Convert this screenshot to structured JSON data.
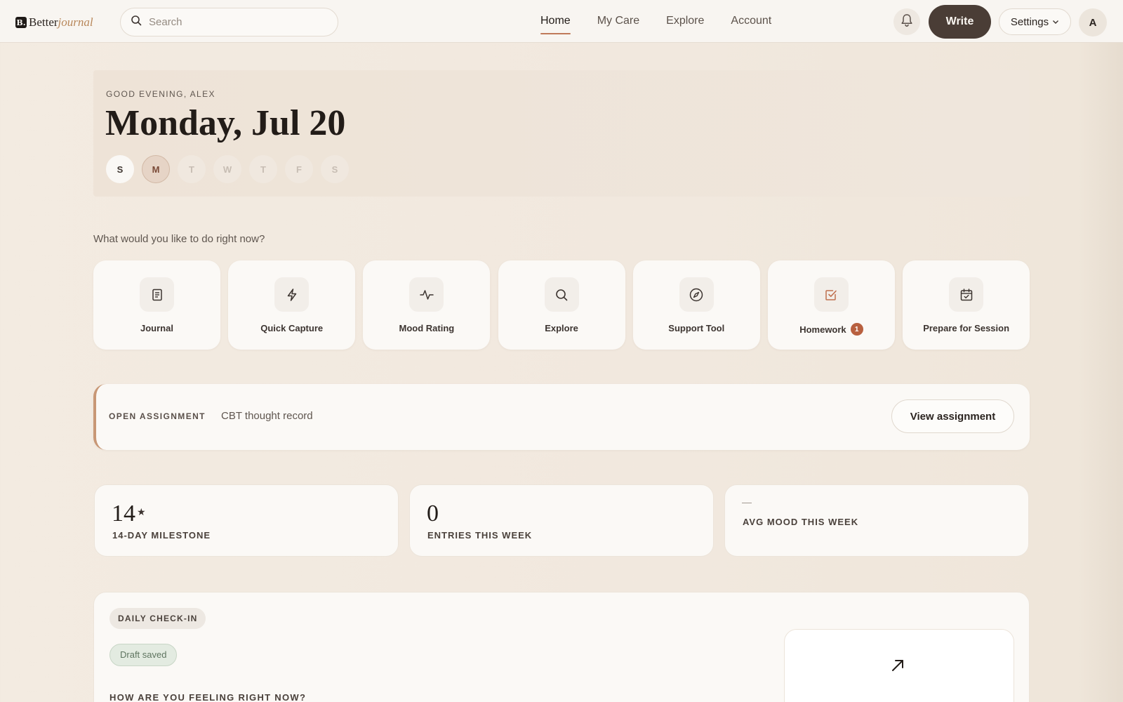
{
  "header": {
    "brand": {
      "mark": "B.",
      "word1": "Better",
      "word2": "journal"
    },
    "search_placeholder": "Search",
    "nav": [
      {
        "label": "Home",
        "active": true
      },
      {
        "label": "My Care",
        "active": false
      },
      {
        "label": "Explore",
        "active": false
      },
      {
        "label": "Account",
        "active": false
      }
    ],
    "write_label": "Write",
    "settings_label": "Settings",
    "avatar_initial": "A"
  },
  "hero": {
    "greeting": "GOOD EVENING, ALEX",
    "date": "Monday, Jul 20",
    "days": [
      {
        "letter": "S",
        "state": "past"
      },
      {
        "letter": "M",
        "state": "today"
      },
      {
        "letter": "T",
        "state": "future"
      },
      {
        "letter": "W",
        "state": "future"
      },
      {
        "letter": "T",
        "state": "future"
      },
      {
        "letter": "F",
        "state": "future"
      },
      {
        "letter": "S",
        "state": "future"
      }
    ]
  },
  "prompt": "What would you like to do right now?",
  "actions": [
    {
      "label": "Journal",
      "icon": "book-icon"
    },
    {
      "label": "Quick Capture",
      "icon": "lightning-icon"
    },
    {
      "label": "Mood Rating",
      "icon": "pulse-icon"
    },
    {
      "label": "Explore",
      "icon": "search-icon"
    },
    {
      "label": "Support Tool",
      "icon": "compass-icon"
    },
    {
      "label": "Homework",
      "icon": "checkbox-icon",
      "badge": "1"
    },
    {
      "label": "Prepare for Session",
      "icon": "calendar-icon"
    }
  ],
  "assignment": {
    "kicker": "OPEN ASSIGNMENT",
    "title": "CBT thought record",
    "button": "View assignment"
  },
  "stats": [
    {
      "value": "14",
      "star": "★",
      "label": "14-DAY MILESTONE"
    },
    {
      "value": "0",
      "label": "ENTRIES THIS WEEK"
    },
    {
      "value": "—",
      "label": "AVG MOOD THIS WEEK"
    }
  ],
  "checkin": {
    "pill": "DAILY CHECK-IN",
    "draft": "Draft saved",
    "question": "HOW ARE YOU FEELING RIGHT NOW?"
  },
  "colors": {
    "accent": "#c07a5a",
    "write_button": "#4a3d36",
    "badge": "#b8603f",
    "assignment_border": "#c89775",
    "draft_green": "#e3ebe1"
  }
}
